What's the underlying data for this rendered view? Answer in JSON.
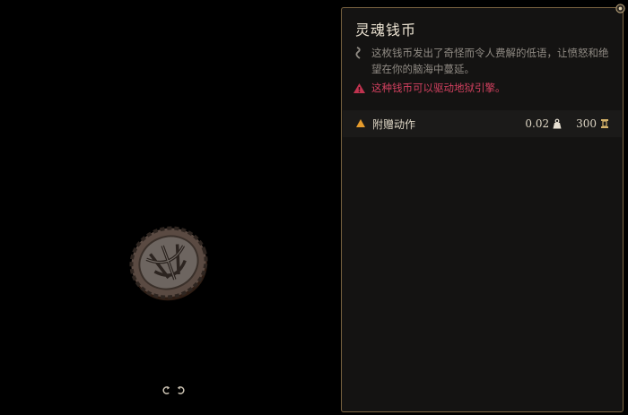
{
  "item": {
    "name": "灵魂钱币",
    "description": "这枚钱币发出了奇怪而令人费解的低语，让愤怒和绝望在你的脑海中蔓延。",
    "warning": "这种钱币可以驱动地狱引擎。"
  },
  "action": {
    "label": "附赠动作",
    "weight": "0.02",
    "value": "300"
  },
  "icons": {
    "description": "whisper-icon",
    "warning": "hellfire-icon",
    "action": "bonus-action-icon",
    "weight": "weight-icon",
    "value": "gold-icon",
    "corner": "gem-icon",
    "rotate_left": "rotate-left-icon",
    "rotate_right": "rotate-right-icon"
  },
  "colors": {
    "panel_border": "#7a6340",
    "warning_text": "#d2405f",
    "action_icon": "#e59b2c"
  }
}
